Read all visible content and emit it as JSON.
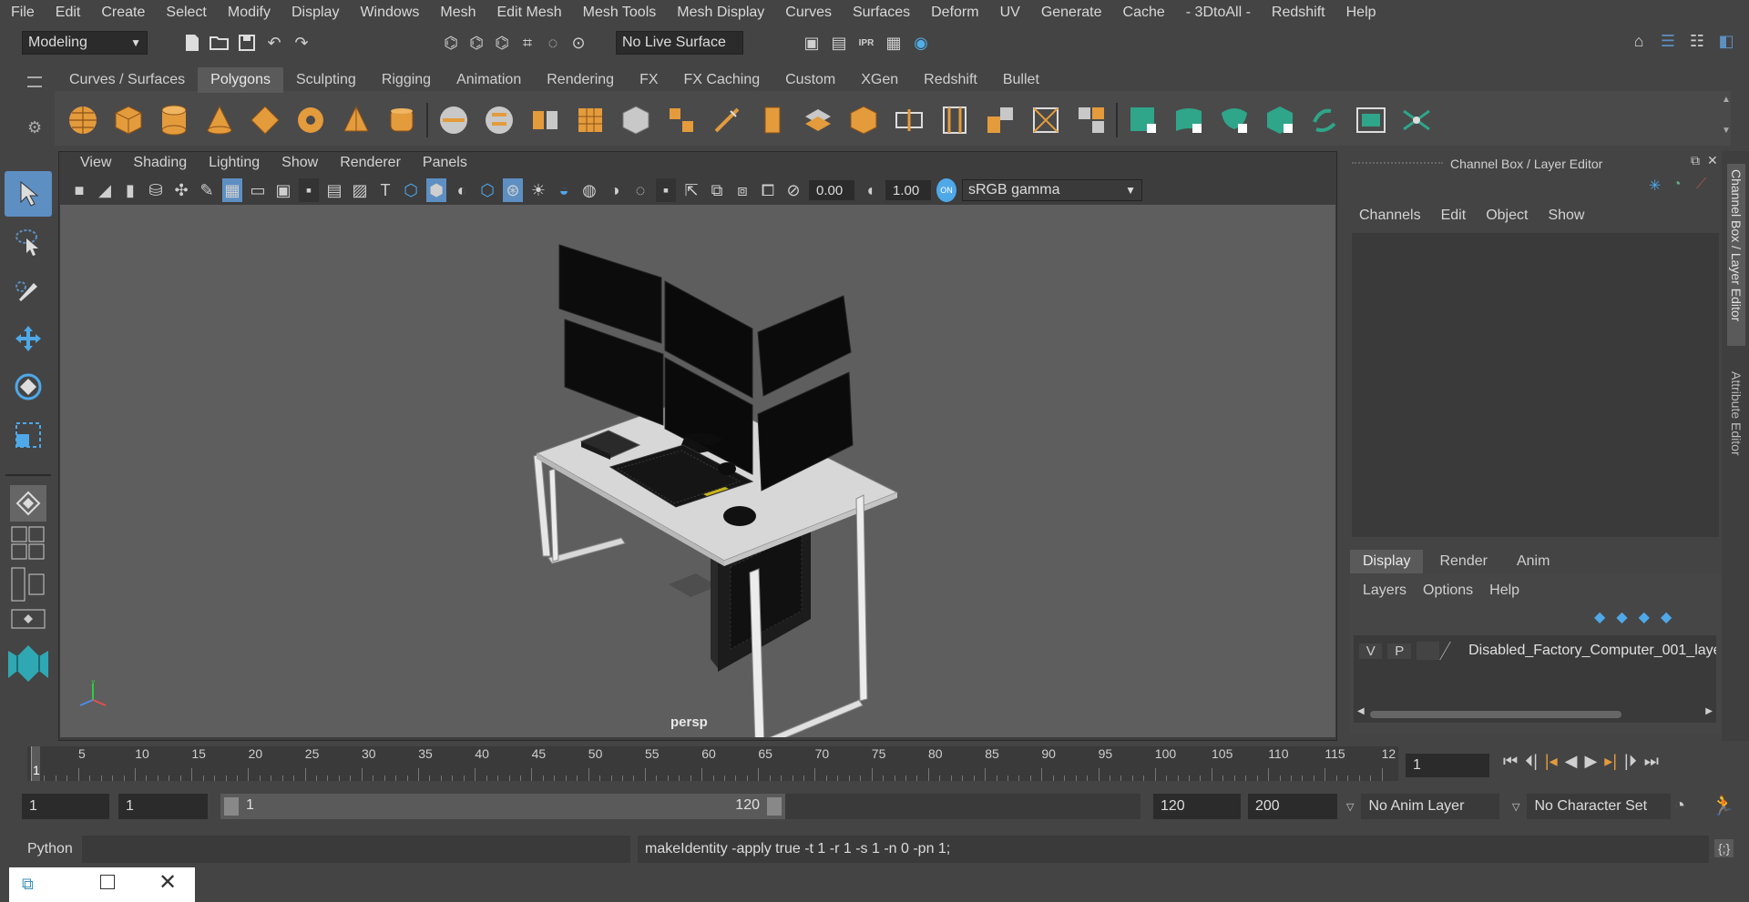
{
  "menubar": [
    "File",
    "Edit",
    "Create",
    "Select",
    "Modify",
    "Display",
    "Windows",
    "Mesh",
    "Edit Mesh",
    "Mesh Tools",
    "Mesh Display",
    "Curves",
    "Surfaces",
    "Deform",
    "UV",
    "Generate",
    "Cache",
    "- 3DtoAll -",
    "Redshift",
    "Help"
  ],
  "status": {
    "mode": "Modeling",
    "live_surface": "No Live Surface"
  },
  "shelf": {
    "tabs": [
      "Curves / Surfaces",
      "Polygons",
      "Sculpting",
      "Rigging",
      "Animation",
      "Rendering",
      "FX",
      "FX Caching",
      "Custom",
      "XGen",
      "Redshift",
      "Bullet"
    ],
    "active_tab": "Polygons"
  },
  "viewport": {
    "menu": [
      "View",
      "Shading",
      "Lighting",
      "Show",
      "Renderer",
      "Panels"
    ],
    "exposure": "0.00",
    "gamma": "1.00",
    "color_space": "sRGB gamma",
    "camera": "persp"
  },
  "channel_box": {
    "title": "Channel Box / Layer Editor",
    "menu": [
      "Channels",
      "Edit",
      "Object",
      "Show"
    ],
    "layer_tabs": [
      "Display",
      "Render",
      "Anim"
    ],
    "layer_menu": [
      "Layers",
      "Options",
      "Help"
    ],
    "layer": {
      "v": "V",
      "p": "P",
      "name": "Disabled_Factory_Computer_001_laye"
    },
    "side_tabs": [
      "Channel Box / Layer Editor",
      "Attribute Editor"
    ]
  },
  "timeline": {
    "ticks": [
      "5",
      "10",
      "15",
      "20",
      "25",
      "30",
      "35",
      "40",
      "45",
      "50",
      "55",
      "60",
      "65",
      "70",
      "75",
      "80",
      "85",
      "90",
      "95",
      "100",
      "105",
      "110",
      "115",
      "12"
    ],
    "current_marker": "1",
    "current_frame": "1"
  },
  "range": {
    "start": "1",
    "playback_start": "1",
    "slider_start": "1",
    "slider_end": "120",
    "playback_end": "120",
    "end": "200",
    "anim_layer": "No Anim Layer",
    "char_set": "No Character Set"
  },
  "command": {
    "lang": "Python",
    "result": "makeIdentity -apply true -t 1 -r 1 -s 1 -n 0 -pn 1;"
  },
  "colors": {
    "accent_blue": "#5d8fc2",
    "shelf_orange": "#e39b3c",
    "shelf_teal": "#2fa58a",
    "bg": "#444444",
    "viewport": "#5e5e5e"
  }
}
